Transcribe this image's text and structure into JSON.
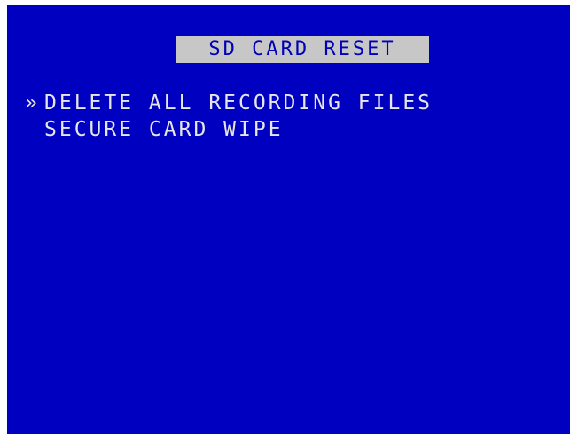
{
  "screen": {
    "title": "SD CARD RESET",
    "background_color": "#0000c0",
    "title_bar_color": "#c7c7c7",
    "text_color": "#e6e6e6"
  },
  "menu": {
    "cursor_glyph": "»",
    "items": [
      {
        "label": "DELETE ALL RECORDING FILES",
        "selected": true
      },
      {
        "label": "SECURE CARD WIPE",
        "selected": false
      }
    ]
  }
}
